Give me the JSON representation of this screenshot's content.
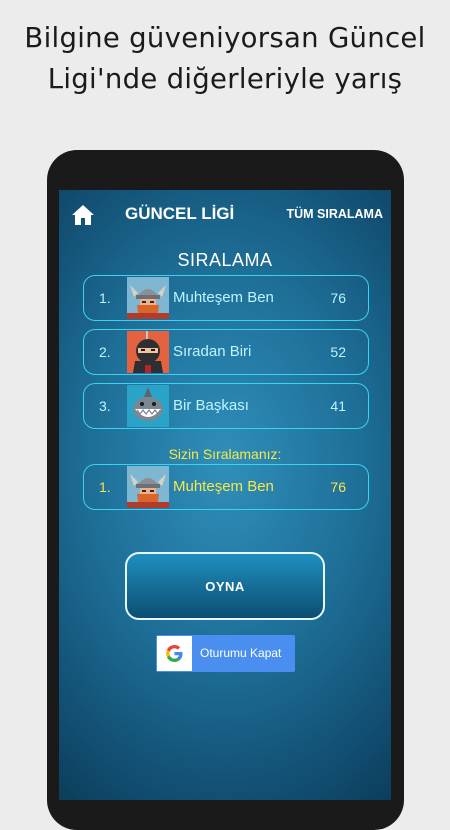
{
  "headline": {
    "line1": "Bilgine güveniyorsan Güncel",
    "line2": "Ligi'nde diğerleriyle yarış"
  },
  "topbar": {
    "home_icon": "home-icon",
    "title": "GÜNCEL LİGİ",
    "all_ranking": "TÜM SIRALAMA"
  },
  "ranking": {
    "heading": "SIRALAMA",
    "rows": [
      {
        "pos": "1.",
        "name": "Muhteşem Ben",
        "score": "76",
        "avatar": "viking-avatar"
      },
      {
        "pos": "2.",
        "name": "Sıradan Biri",
        "score": "52",
        "avatar": "ninja-avatar"
      },
      {
        "pos": "3.",
        "name": "Bir Başkası",
        "score": "41",
        "avatar": "shark-avatar"
      }
    ]
  },
  "your_ranking": {
    "label": "Sizin Sıralamanız:",
    "row": {
      "pos": "1.",
      "name": "Muhteşem Ben",
      "score": "76",
      "avatar": "viking-avatar"
    }
  },
  "buttons": {
    "play": "OYNA",
    "sign_out": "Oturumu Kapat",
    "sign_out_icon": "google-icon"
  },
  "colors": {
    "accent": "#39d3f5",
    "highlight": "#f7e847",
    "google_blue": "#4a8ff0"
  }
}
